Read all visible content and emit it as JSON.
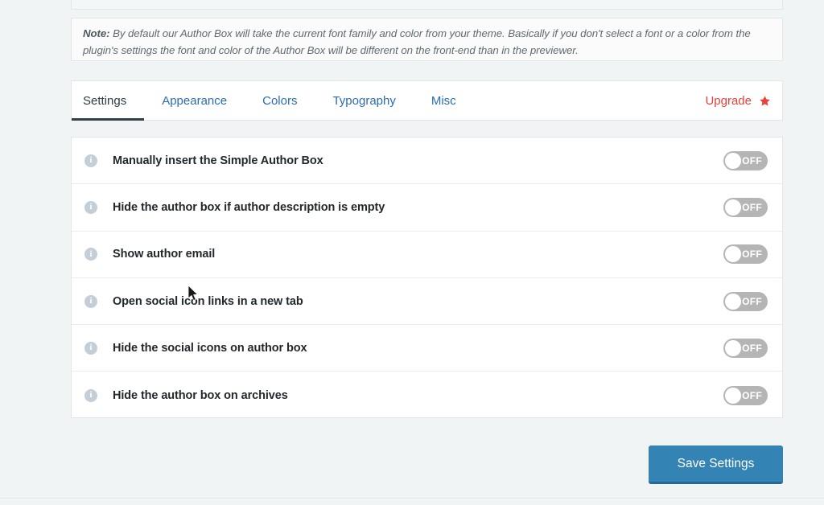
{
  "note": {
    "label": "Note:",
    "text": " By default our Author Box will take the current font family and color from your theme. Basically if you don't select a font or a color from the plugin's settings the font and color of the Author Box will be different on the front-end than in the previewer."
  },
  "tabs": {
    "items": [
      {
        "label": "Settings",
        "active": true
      },
      {
        "label": "Appearance",
        "active": false
      },
      {
        "label": "Colors",
        "active": false
      },
      {
        "label": "Typography",
        "active": false
      },
      {
        "label": "Misc",
        "active": false
      }
    ],
    "upgrade_label": "Upgrade",
    "upgrade_icon": "star-icon",
    "upgrade_color": "#e8423b",
    "active_underline_color": "#32404e",
    "link_color": "#2b6cb5"
  },
  "settings": {
    "rows": [
      {
        "label": "Manually insert the Simple Author Box",
        "toggle": "OFF",
        "info_icon": "info-icon"
      },
      {
        "label": "Hide the author box if author description is empty",
        "toggle": "OFF",
        "info_icon": "info-icon"
      },
      {
        "label": "Show author email",
        "toggle": "OFF",
        "info_icon": "info-icon"
      },
      {
        "label": "Open social icon links in a new tab",
        "toggle": "OFF",
        "info_icon": "info-icon"
      },
      {
        "label": "Hide the social icons on author box",
        "toggle": "OFF",
        "info_icon": "info-icon"
      },
      {
        "label": "Hide the author box on archives",
        "toggle": "OFF",
        "info_icon": "info-icon"
      }
    ],
    "toggle_off_color": "#b5b5b5",
    "info_icon_color": "#c3ced6"
  },
  "footer": {
    "save_label": "Save Settings",
    "save_color": "#3383b4"
  }
}
